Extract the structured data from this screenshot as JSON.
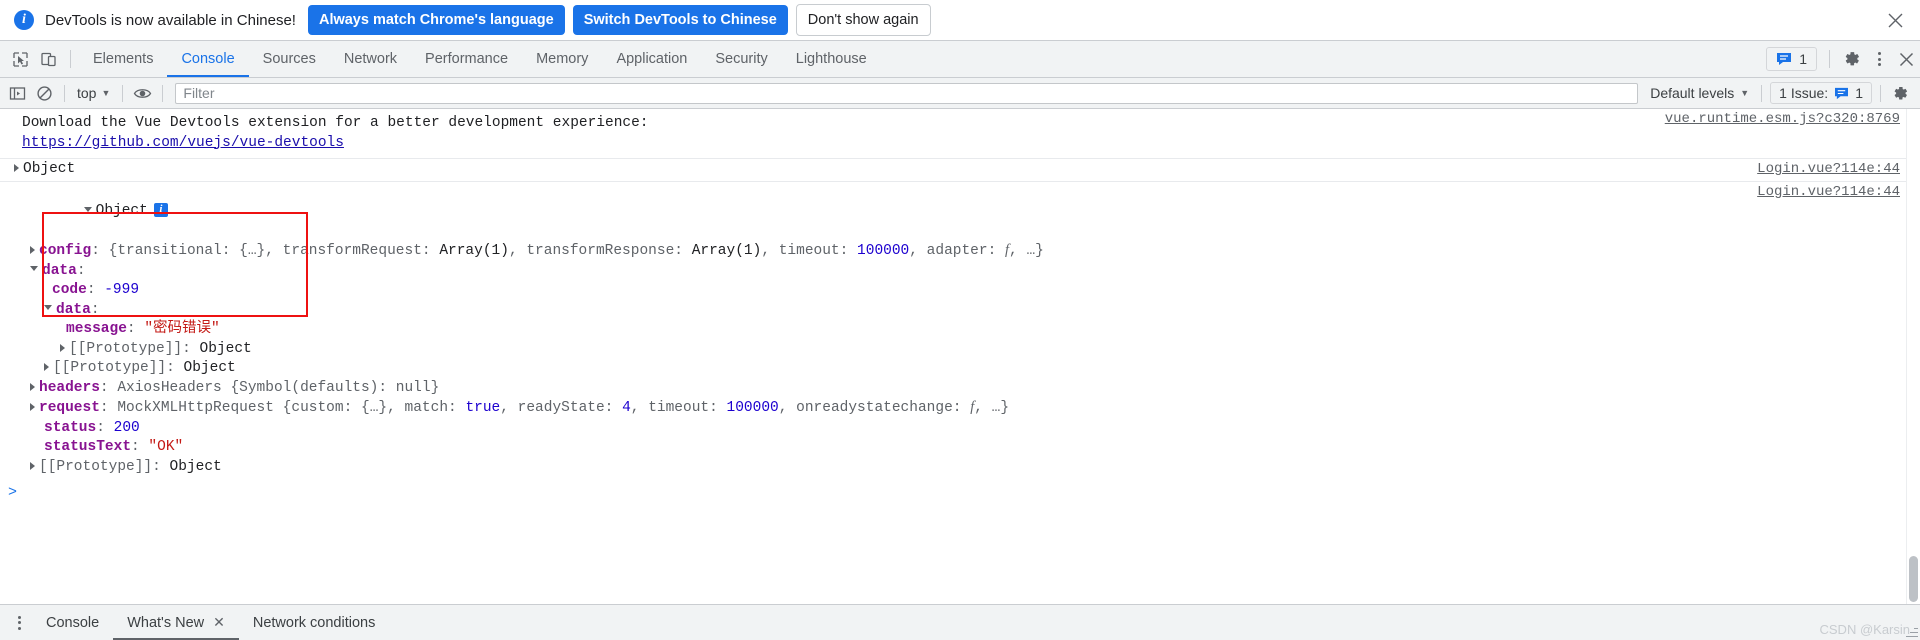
{
  "infobar": {
    "icon": "info-icon",
    "message": "DevTools is now available in Chinese!",
    "primary_button": "Always match Chrome's language",
    "secondary_button": "Switch DevTools to Chinese",
    "dismiss_button": "Don't show again",
    "close_icon": "close-icon",
    "accent_color": "#1a73e8"
  },
  "tabbar": {
    "inspect_icon": "inspect-element-icon",
    "device_icon": "device-toolbar-icon",
    "tabs": [
      {
        "label": "Elements",
        "active": false
      },
      {
        "label": "Console",
        "active": true
      },
      {
        "label": "Sources",
        "active": false
      },
      {
        "label": "Network",
        "active": false
      },
      {
        "label": "Performance",
        "active": false
      },
      {
        "label": "Memory",
        "active": false
      },
      {
        "label": "Application",
        "active": false
      },
      {
        "label": "Security",
        "active": false
      },
      {
        "label": "Lighthouse",
        "active": false
      }
    ],
    "message_badge_icon": "message-icon",
    "message_badge_count": "1",
    "settings_icon": "gear-icon",
    "more_icon": "kebab-menu-icon",
    "close_icon": "close-icon"
  },
  "console_toolbar": {
    "sidebar_icon": "console-sidebar-icon",
    "clear_icon": "clear-console-icon",
    "context_label": "top",
    "context_caret": "chevron-down-icon",
    "eye_icon": "live-expression-icon",
    "filter_placeholder": "Filter",
    "filter_value": "",
    "levels_label": "Default levels",
    "levels_caret": "chevron-down-icon",
    "issues_label": "1 Issue:",
    "issues_icon": "message-icon",
    "issues_count": "1",
    "settings_icon": "gear-icon"
  },
  "console": {
    "vue_message_line1": "Download the Vue Devtools extension for a better development experience:",
    "vue_message_link": "https://github.com/vuejs/vue-devtools",
    "vue_source_link": "vue.runtime.esm.js?c320:8769",
    "object1": {
      "label": "Object",
      "source_link": "Login.vue?114e:44"
    },
    "object2": {
      "label": "Object",
      "info_badge": "i",
      "source_link": "Login.vue?114e:44"
    },
    "props": {
      "config_key": "config",
      "config_value_pre": ": {",
      "config_transitional_key": "transitional",
      "config_transitional_value": "{…}",
      "config_transformRequest_key": "transformRequest",
      "config_transformRequest_value": "Array(1)",
      "config_transformResponse_key": "transformResponse",
      "config_transformResponse_value": "Array(1)",
      "config_timeout_key": "timeout",
      "config_timeout_value": "100000",
      "config_adapter_key": "adapter",
      "config_adapter_value": "f",
      "config_ellipsis": "…}",
      "data_key": "data",
      "code_key": "code",
      "code_value": "-999",
      "inner_data_key": "data",
      "message_key": "message",
      "message_value": "\"密码错误\"",
      "prototype_label": "[[Prototype]]",
      "prototype_value": "Object",
      "headers_key": "headers",
      "headers_value_class": "AxiosHeaders",
      "headers_value_body": "{Symbol(defaults): null}",
      "request_key": "request",
      "request_value_class": "MockXMLHttpRequest",
      "request_custom_key": "custom",
      "request_custom_value": "{…}",
      "request_match_key": "match",
      "request_match_value": "true",
      "request_readyState_key": "readyState",
      "request_readyState_value": "4",
      "request_timeout_key": "timeout",
      "request_timeout_value": "100000",
      "request_onreadystatechange_key": "onreadystatechange",
      "request_onreadystatechange_value": "f",
      "request_ellipsis": "…}",
      "status_key": "status",
      "status_value": "200",
      "statusText_key": "statusText",
      "statusText_value": "\"OK\""
    },
    "highlight_color": "#ee1111",
    "prompt_arrow": ">"
  },
  "drawer": {
    "more_icon": "kebab-menu-icon",
    "tabs": [
      {
        "label": "Console",
        "closable": false,
        "active": false
      },
      {
        "label": "What's New",
        "closable": true,
        "active": true
      },
      {
        "label": "Network conditions",
        "closable": false,
        "active": false
      }
    ],
    "close_glyph": "✕",
    "watermark": "CSDN @Karsin"
  }
}
